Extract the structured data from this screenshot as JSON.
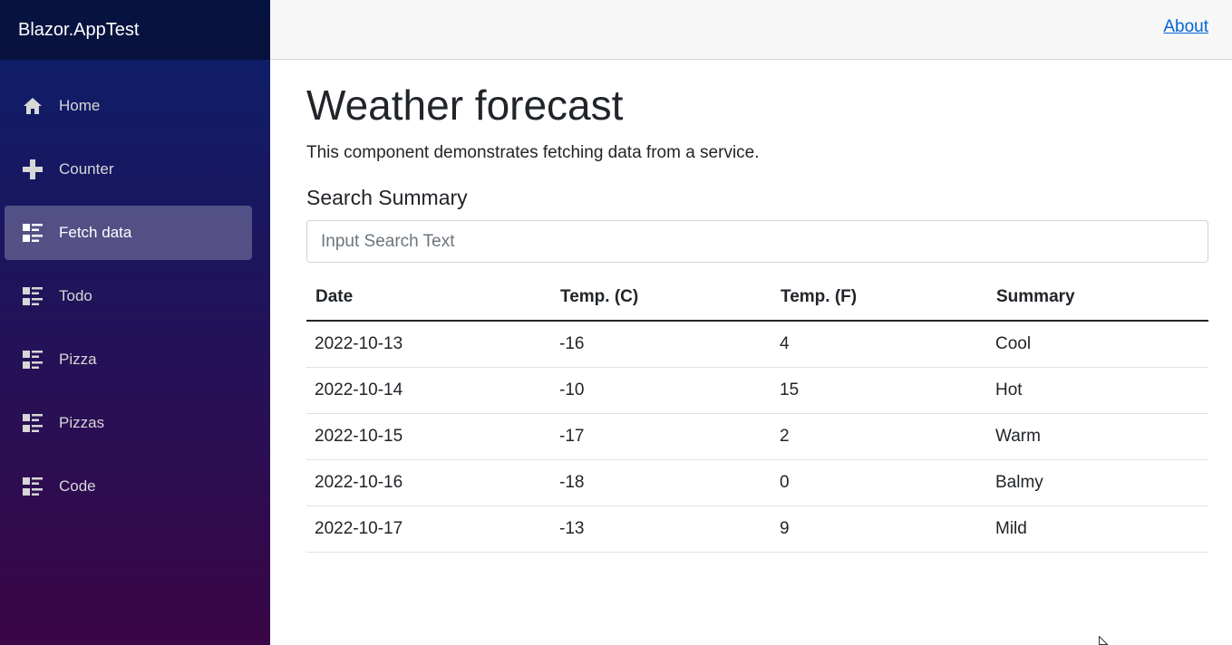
{
  "sidebar": {
    "brand": "Blazor.AppTest",
    "items": [
      {
        "label": "Home",
        "icon": "home-icon",
        "active": false
      },
      {
        "label": "Counter",
        "icon": "plus-icon",
        "active": false
      },
      {
        "label": "Fetch data",
        "icon": "list-rich-icon",
        "active": true
      },
      {
        "label": "Todo",
        "icon": "list-rich-icon",
        "active": false
      },
      {
        "label": "Pizza",
        "icon": "list-rich-icon",
        "active": false
      },
      {
        "label": "Pizzas",
        "icon": "list-rich-icon",
        "active": false
      },
      {
        "label": "Code",
        "icon": "list-rich-icon",
        "active": false
      }
    ]
  },
  "topbar": {
    "about": "About"
  },
  "main": {
    "title": "Weather forecast",
    "description": "This component demonstrates fetching data from a service.",
    "search_heading": "Search Summary",
    "search_placeholder": "Input Search Text",
    "table": {
      "headers": [
        "Date",
        "Temp. (C)",
        "Temp. (F)",
        "Summary"
      ],
      "rows": [
        [
          "2022-10-13",
          "-16",
          "4",
          "Cool"
        ],
        [
          "2022-10-14",
          "-10",
          "15",
          "Hot"
        ],
        [
          "2022-10-15",
          "-17",
          "2",
          "Warm"
        ],
        [
          "2022-10-16",
          "-18",
          "0",
          "Balmy"
        ],
        [
          "2022-10-17",
          "-13",
          "9",
          "Mild"
        ]
      ]
    }
  },
  "colors": {
    "sidebar_top": "#0a1f6b",
    "sidebar_bottom": "#3a0647",
    "link": "#0366d6"
  }
}
